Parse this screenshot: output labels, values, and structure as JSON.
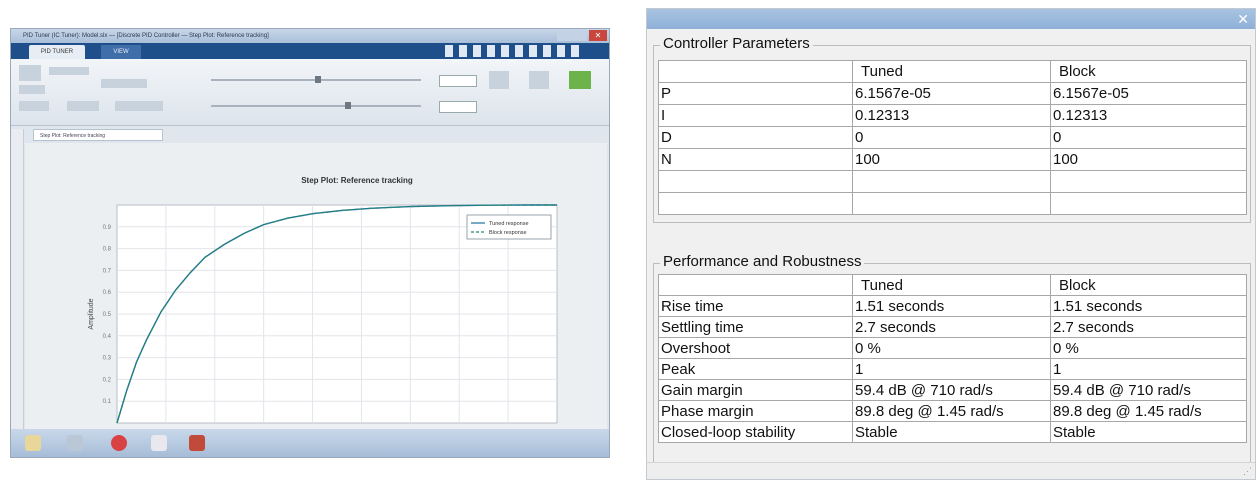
{
  "tuner": {
    "title": "PID Tuner (IC Tuner): Model.slx — [Discrete PID Controller — Step Plot: Reference tracking]",
    "tabs": [
      "PID TUNER",
      "VIEW"
    ],
    "document_tab": "Step Plot: Reference tracking",
    "close_glyph": "✕"
  },
  "chart_data": {
    "type": "line",
    "title": "Step Plot: Reference tracking",
    "xlabel": "",
    "ylabel": "Amplitude",
    "ylim": [
      0,
      1
    ],
    "yticks": [
      "0.1",
      "0.2",
      "0.3",
      "0.4",
      "0.5",
      "0.6",
      "0.7",
      "0.8",
      "0.9"
    ],
    "xlim": [
      0,
      4.5
    ],
    "grid": true,
    "legend_position": "top-right",
    "x": [
      0,
      0.1,
      0.2,
      0.3,
      0.45,
      0.6,
      0.75,
      0.9,
      1.1,
      1.3,
      1.5,
      1.75,
      2.0,
      2.3,
      2.6,
      3.0,
      3.4,
      3.8,
      4.2,
      4.5
    ],
    "series": [
      {
        "name": "Tuned response",
        "style": "solid",
        "color": "#1d6fa5",
        "values": [
          0,
          0.15,
          0.28,
          0.38,
          0.51,
          0.61,
          0.69,
          0.76,
          0.82,
          0.87,
          0.91,
          0.94,
          0.96,
          0.975,
          0.985,
          0.993,
          0.997,
          0.999,
          1.0,
          1.0
        ]
      },
      {
        "name": "Block response",
        "style": "dashed",
        "color": "#2b8a6e",
        "values": [
          0,
          0.15,
          0.28,
          0.38,
          0.51,
          0.61,
          0.69,
          0.76,
          0.82,
          0.87,
          0.91,
          0.94,
          0.96,
          0.975,
          0.985,
          0.993,
          0.997,
          0.999,
          1.0,
          1.0
        ]
      }
    ]
  },
  "params": {
    "close_glyph": "✕",
    "grip": "⋰",
    "controller": {
      "title": "Controller Parameters",
      "headers": [
        "",
        "Tuned",
        "Block"
      ],
      "rows": [
        [
          "P",
          "6.1567e-05",
          "6.1567e-05"
        ],
        [
          "I",
          "0.12313",
          "0.12313"
        ],
        [
          "D",
          "0",
          "0"
        ],
        [
          "N",
          "100",
          "100"
        ],
        [
          "",
          "",
          ""
        ],
        [
          "",
          "",
          ""
        ]
      ]
    },
    "performance": {
      "title": "Performance and Robustness",
      "headers": [
        "",
        "Tuned",
        "Block"
      ],
      "rows": [
        [
          "Rise time",
          "1.51 seconds",
          "1.51 seconds"
        ],
        [
          "Settling time",
          "2.7 seconds",
          "2.7 seconds"
        ],
        [
          "Overshoot",
          "0 %",
          "0 %"
        ],
        [
          "Peak",
          "1",
          "1"
        ],
        [
          "Gain margin",
          "59.4 dB @ 710 rad/s",
          "59.4 dB @ 710 rad/s"
        ],
        [
          "Phase margin",
          "89.8 deg @ 1.45 rad/s",
          "89.8 deg @ 1.45 rad/s"
        ],
        [
          "Closed-loop stability",
          "Stable",
          "Stable"
        ]
      ]
    }
  }
}
